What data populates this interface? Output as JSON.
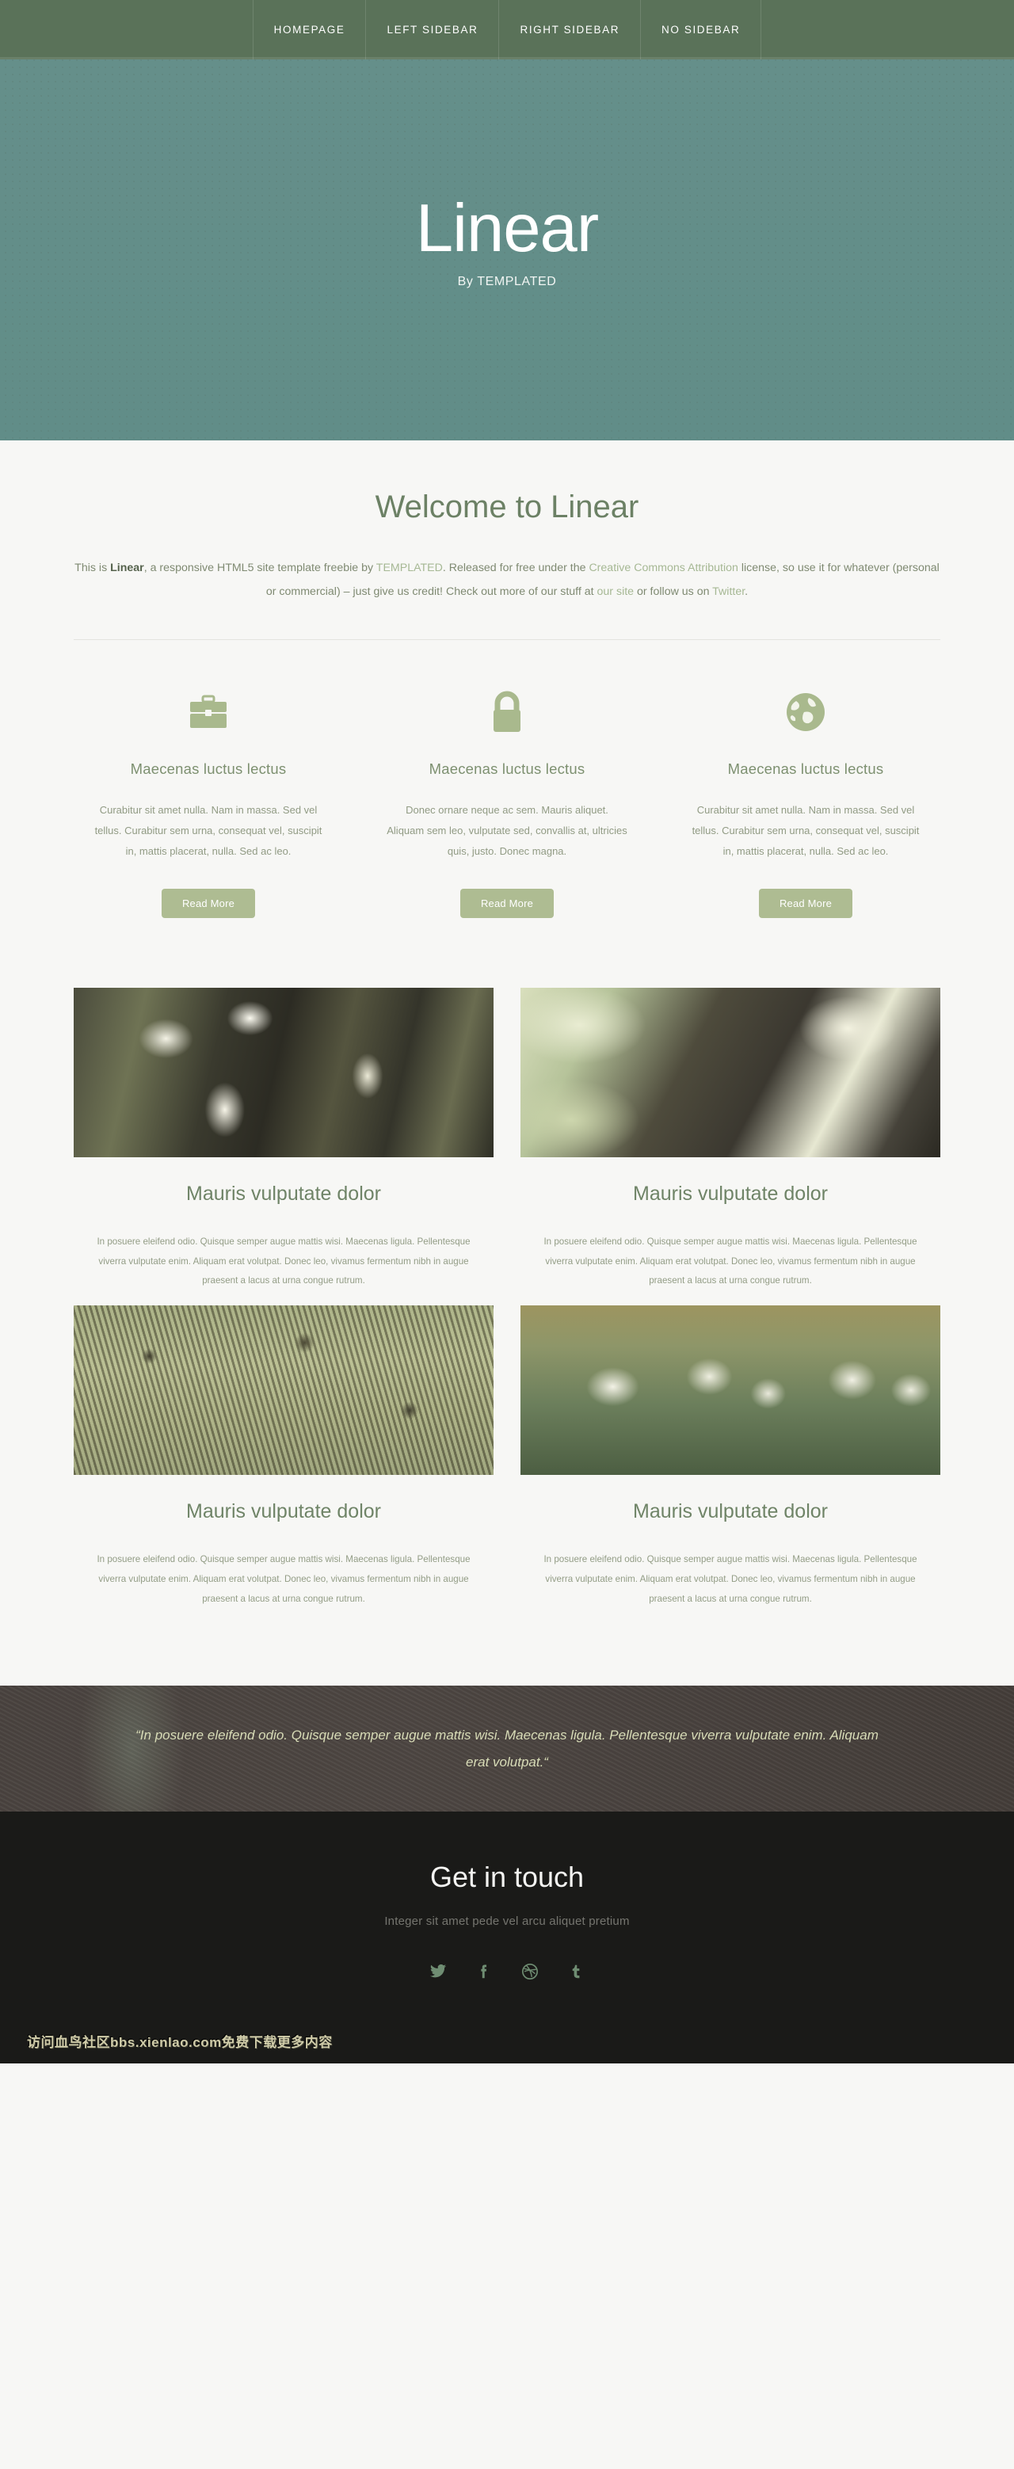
{
  "nav": {
    "items": [
      {
        "label": "HOMEPAGE",
        "name": "nav-item-homepage"
      },
      {
        "label": "LEFT SIDEBAR",
        "name": "nav-item-left-sidebar"
      },
      {
        "label": "RIGHT SIDEBAR",
        "name": "nav-item-right-sidebar"
      },
      {
        "label": "NO SIDEBAR",
        "name": "nav-item-no-sidebar"
      }
    ]
  },
  "hero": {
    "title": "Linear",
    "subtitle": "By TEMPLATED",
    "bg_color": "#648f8a"
  },
  "welcome": {
    "title": "Welcome to Linear",
    "text_part1": "This is ",
    "text_bold": "Linear",
    "text_part2": ", a responsive HTML5 site template freebie by ",
    "link_templated": "TEMPLATED",
    "text_part3": ". Released for free under the ",
    "link_cc": "Creative Commons Attribution",
    "text_part4": " license, so use it for whatever (personal or commercial) – just give us credit! Check out more of our stuff at ",
    "link_oursite": "our site",
    "text_part5": " or follow us on ",
    "link_twitter": "Twitter",
    "text_part6": "."
  },
  "features": [
    {
      "icon": "briefcase-icon",
      "title": "Maecenas luctus lectus",
      "description": "Curabitur sit amet nulla. Nam in massa. Sed vel tellus. Curabitur sem urna, consequat vel, suscipit in, mattis placerat, nulla. Sed ac leo.",
      "button": "Read More"
    },
    {
      "icon": "lock-icon",
      "title": "Maecenas luctus lectus",
      "description": "Donec ornare neque ac sem. Mauris aliquet. Aliquam sem leo, vulputate sed, convallis at, ultricies quis, justo. Donec magna.",
      "button": "Read More"
    },
    {
      "icon": "globe-icon",
      "title": "Maecenas luctus lectus",
      "description": "Curabitur sit amet nulla. Nam in massa. Sed vel tellus. Curabitur sem urna, consequat vel, suscipit in, mattis placerat, nulla. Sed ac leo.",
      "button": "Read More"
    }
  ],
  "gallery": [
    {
      "image": "forest-canopy-photo",
      "title": "Mauris vulputate dolor",
      "description": "In posuere eleifend odio. Quisque semper augue mattis wisi. Maecenas ligula. Pellentesque viverra vulputate enim. Aliquam erat volutpat. Donec leo, vivamus fermentum nibh in augue praesent a lacus at urna congue rutrum."
    },
    {
      "image": "leaf-closeup-photo",
      "title": "Mauris vulputate dolor",
      "description": "In posuere eleifend odio. Quisque semper augue mattis wisi. Maecenas ligula. Pellentesque viverra vulputate enim. Aliquam erat volutpat. Donec leo, vivamus fermentum nibh in augue praesent a lacus at urna congue rutrum."
    },
    {
      "image": "shrubland-photo",
      "title": "Mauris vulputate dolor",
      "description": "In posuere eleifend odio. Quisque semper augue mattis wisi. Maecenas ligula. Pellentesque viverra vulputate enim. Aliquam erat volutpat. Donec leo, vivamus fermentum nibh in augue praesent a lacus at urna congue rutrum."
    },
    {
      "image": "sheep-field-photo",
      "title": "Mauris vulputate dolor",
      "description": "In posuere eleifend odio. Quisque semper augue mattis wisi. Maecenas ligula. Pellentesque viverra vulputate enim. Aliquam erat volutpat. Donec leo, vivamus fermentum nibh in augue praesent a lacus at urna congue rutrum."
    }
  ],
  "quote": {
    "text": "“In posuere eleifend odio. Quisque semper augue mattis wisi. Maecenas ligula. Pellentesque viverra vulputate enim. Aliquam erat volutpat.“"
  },
  "footer": {
    "title": "Get in touch",
    "subtitle": "Integer sit amet pede vel arcu aliquet pretium",
    "social": [
      {
        "name": "twitter-icon",
        "label": "Twitter"
      },
      {
        "name": "facebook-icon",
        "label": "Facebook"
      },
      {
        "name": "dribbble-icon",
        "label": "Dribbble"
      },
      {
        "name": "tumblr-icon",
        "label": "Tumblr"
      }
    ]
  },
  "watermark": {
    "text": "访问血鸟社区bbs.xienlao.com免费下载更多内容"
  },
  "colors": {
    "nav_bg": "#5a7259",
    "hero_bg": "#648f8a",
    "accent_green": "#7d9070",
    "button_green": "#aebc92",
    "page_bg": "#f7f7f5",
    "quote_bg": "#4a433f",
    "footer_bg": "#1a1a18"
  }
}
